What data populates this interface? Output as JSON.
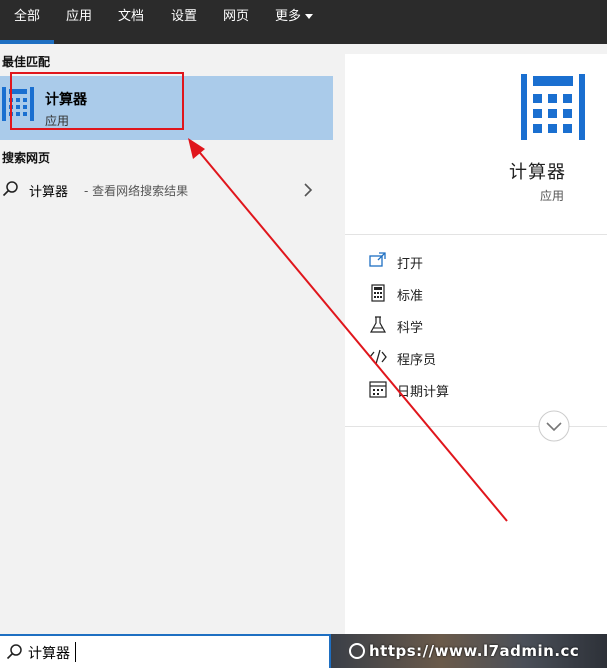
{
  "tabs": [
    {
      "label": "全部",
      "active": true
    },
    {
      "label": "应用"
    },
    {
      "label": "文档"
    },
    {
      "label": "设置"
    },
    {
      "label": "网页"
    },
    {
      "label": "更多",
      "dropdown": true
    }
  ],
  "left": {
    "best_match_label": "最佳匹配",
    "best_match": {
      "title": "计算器",
      "subtitle": "应用",
      "icon": "calculator-icon"
    },
    "web_label": "搜索网页",
    "web_result": {
      "query": "计算器",
      "hint": " - 查看网络搜索结果",
      "icon": "search-icon"
    }
  },
  "right": {
    "title": "计算器",
    "subtitle": "应用",
    "actions": [
      {
        "label": "打开",
        "icon": "open-icon"
      },
      {
        "label": "标准",
        "icon": "standard-calculator-icon"
      },
      {
        "label": "科学",
        "icon": "flask-icon"
      },
      {
        "label": "程序员",
        "icon": "code-icon"
      },
      {
        "label": "日期计算",
        "icon": "calendar-icon"
      }
    ]
  },
  "search": {
    "value": "计算器"
  },
  "watermark": "https://www.l7admin.cc",
  "colors": {
    "accent": "#1e6fc2",
    "selection": "#aacbea",
    "annotation": "#e0161c",
    "topbar": "#2b2b2b"
  }
}
